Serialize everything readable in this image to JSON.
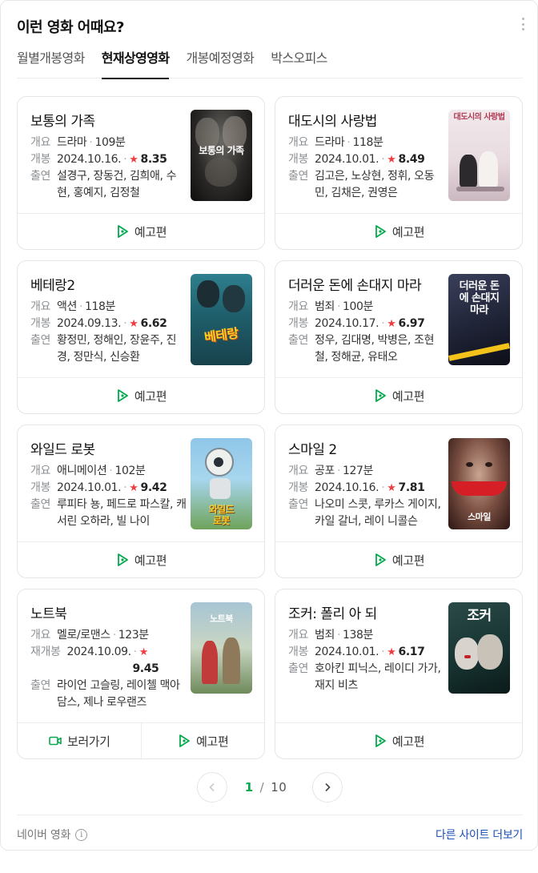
{
  "header": {
    "title": "이런 영화 어때요?"
  },
  "tabs": [
    {
      "label": "월별개봉영화",
      "active": false
    },
    {
      "label": "현재상영영화",
      "active": true
    },
    {
      "label": "개봉예정영화",
      "active": false
    },
    {
      "label": "박스오피스",
      "active": false
    }
  ],
  "labels": {
    "summary": "개요",
    "release": "개봉",
    "rerelease": "재개봉",
    "cast": "출연",
    "trailer": "예고편",
    "watch": "보러가기"
  },
  "movies": [
    {
      "title": "보통의 가족",
      "genre": "드라마",
      "runtime": "109분",
      "release_label": "개봉",
      "date": "2024.10.16.",
      "rating": "8.35",
      "cast": "설경구, 장동건, 김희애, 수현, 홍예지, 김정철",
      "poster_text": "보통의 가족",
      "poster_icon": "poster-family",
      "buttons": [
        "예고편"
      ]
    },
    {
      "title": "대도시의 사랑법",
      "genre": "드라마",
      "runtime": "118분",
      "release_label": "개봉",
      "date": "2024.10.01.",
      "rating": "8.49",
      "cast": "김고은, 노상현, 정휘, 오동민, 김채은, 권영은",
      "poster_text": "대도시의 사랑법",
      "poster_icon": "poster-love-city",
      "buttons": [
        "예고편"
      ]
    },
    {
      "title": "베테랑2",
      "genre": "액션",
      "runtime": "118분",
      "release_label": "개봉",
      "date": "2024.09.13.",
      "rating": "6.62",
      "cast": "황정민, 정해인, 장윤주, 진경, 정만식, 신승환",
      "poster_text": "베테랑",
      "poster_icon": "poster-veteran",
      "buttons": [
        "예고편"
      ]
    },
    {
      "title": "더러운 돈에 손대지 마라",
      "genre": "범죄",
      "runtime": "100분",
      "release_label": "개봉",
      "date": "2024.10.17.",
      "rating": "6.97",
      "cast": "정우, 김대명, 박병은, 조현철, 정해균, 유태오",
      "poster_text": "더러운 돈에 손대지 마라",
      "poster_icon": "poster-dirty-money",
      "buttons": [
        "예고편"
      ]
    },
    {
      "title": "와일드 로봇",
      "genre": "애니메이션",
      "runtime": "102분",
      "release_label": "개봉",
      "date": "2024.10.01.",
      "rating": "9.42",
      "cast": "루피타 뇽, 페드로 파스칼, 캐서린 오하라, 빌 나이",
      "poster_text": "와일드 로봇",
      "poster_icon": "poster-wild-robot",
      "buttons": [
        "예고편"
      ]
    },
    {
      "title": "스마일 2",
      "genre": "공포",
      "runtime": "127분",
      "release_label": "개봉",
      "date": "2024.10.16.",
      "rating": "7.81",
      "cast": "나오미 스콧, 루카스 게이지, 카일 갈너, 레이 니콜슨",
      "poster_text": "스마일",
      "poster_icon": "poster-smile",
      "buttons": [
        "예고편"
      ]
    },
    {
      "title": "노트북",
      "genre": "멜로/로맨스",
      "runtime": "123분",
      "release_label": "재개봉",
      "date": "2024.10.09.",
      "rating": "9.45",
      "cast": "라이언 고슬링, 레이첼 맥아담스, 제나 로우랜즈",
      "poster_text": "노트북",
      "poster_icon": "poster-notebook",
      "buttons": [
        "보러가기",
        "예고편"
      ]
    },
    {
      "title": "조커: 폴리 아 되",
      "genre": "범죄",
      "runtime": "138분",
      "release_label": "개봉",
      "date": "2024.10.01.",
      "rating": "6.17",
      "cast": "호아킨 피닉스, 레이디 가가, 재지 비츠",
      "poster_text": "조커",
      "poster_icon": "poster-joker",
      "buttons": [
        "예고편"
      ]
    }
  ],
  "pagination": {
    "current": "1",
    "separator": "/",
    "total": "10"
  },
  "footer": {
    "source": "네이버 영화",
    "more_link": "다른 사이트 더보기"
  },
  "colors": {
    "accent_green": "#03a94d",
    "star_red": "#ef3e42",
    "link_blue": "#1c4fb7"
  }
}
